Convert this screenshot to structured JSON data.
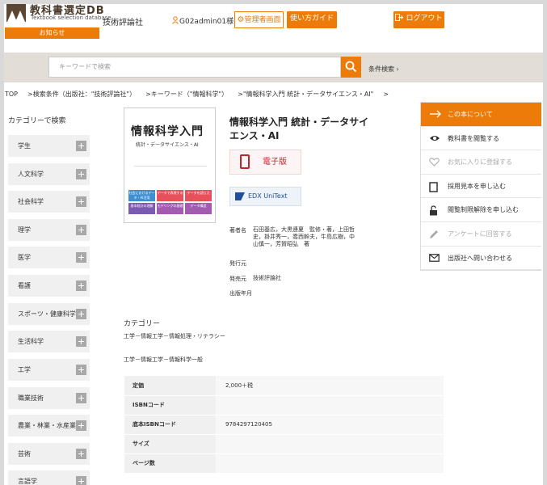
{
  "header": {
    "logo_title": "教科書選定DB",
    "logo_subtitle": "Textbook selection database",
    "notice_label": "お知らせ",
    "publisher": "技術評論社",
    "user": "G02admin01様",
    "admin_label": "管理者画面",
    "guide_label": "使い方ガイド",
    "logout_label": "ログアウト"
  },
  "search": {
    "placeholder": "キーワードで検索",
    "advanced_label": "条件検索"
  },
  "breadcrumb": {
    "home": "TOP",
    "condition": "検索条件（出版社：\"技術評論社\"）",
    "keyword": "キーワード（\"情報科学\"）",
    "current": "\"情報科学入門 統計・データサイエンス・AI\""
  },
  "categories": {
    "title": "カテゴリーで検索",
    "items": [
      "学生",
      "人文科学",
      "社会科学",
      "理学",
      "医学",
      "看護",
      "スポーツ・健康科学",
      "生活科学",
      "工学",
      "職業技術",
      "農業・林業・水産業",
      "芸術",
      "言語学"
    ]
  },
  "book": {
    "cover_title": "情報科学入門",
    "cover_subtitle": "統計・データサイエンス・AI",
    "cover_tiles": [
      "社会におけるデータ・AI活用",
      "データで表現する",
      "データを読む力",
      "基本統計の理解",
      "モデリングの基礎",
      "データ構造"
    ],
    "title": "情報科学入門 統計・データサイエンス・AI",
    "ebook_label": "電子版",
    "edx_label": "EDX UniText",
    "labels": {
      "author": "著者名",
      "publish_origin": "発行元",
      "sales": "発売元",
      "date": "出版年月"
    },
    "authors": "石田基広，大黒連夏　監修・著，上田哲史，掛井秀一，喬西幹夫，牛島広樹，中山慎一，芳賀昭弘　著",
    "publish_origin": "",
    "sales": "技術評論社",
    "date": ""
  },
  "category_section": {
    "title": "カテゴリー",
    "lines": [
      "工学－情報工学－情報処理・リテラシー",
      "工学－情報工学－情報科学一般"
    ]
  },
  "spec_table": [
    {
      "key": "定価",
      "value": "2,000＋税"
    },
    {
      "key": "ISBNコード",
      "value": ""
    },
    {
      "key": "底本ISBNコード",
      "value": "9784297120405"
    },
    {
      "key": "サイズ",
      "value": ""
    },
    {
      "key": "ページ数",
      "value": ""
    }
  ],
  "panel": [
    {
      "label": "この本について",
      "icon": "arrow-right-icon"
    },
    {
      "label": "教科書を閲覧する",
      "icon": "eye-icon"
    },
    {
      "label": "お気に入りに登録する",
      "icon": "heart-icon"
    },
    {
      "label": "採用見本を申し込む",
      "icon": "document-icon"
    },
    {
      "label": "閲覧制限解除を申し込む",
      "icon": "unlock-icon"
    },
    {
      "label": "アンケートに回答する",
      "icon": "pencil-icon"
    },
    {
      "label": "出版社へ問い合わせる",
      "icon": "mail-icon"
    }
  ],
  "colors": {
    "accent": "#ec7b0a",
    "ebook_red": "#c0242b",
    "edx_blue": "#1f4f9a"
  }
}
